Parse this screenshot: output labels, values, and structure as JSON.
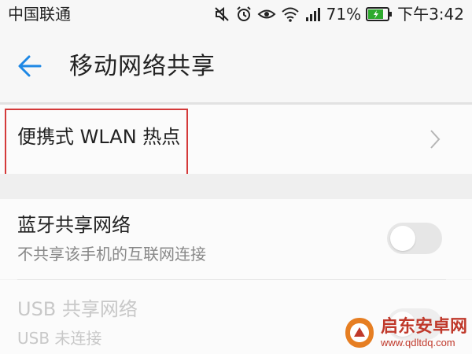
{
  "status_bar": {
    "carrier": "中国联通",
    "battery_percent": "71%",
    "time": "下午3:42",
    "icons": [
      "mute-icon",
      "alarm-icon",
      "eye-icon",
      "wifi-icon",
      "signal-icon",
      "battery-icon"
    ]
  },
  "app_bar": {
    "title": "移动网络共享"
  },
  "items": {
    "hotspot": {
      "label": "便携式 WLAN 热点"
    },
    "bluetooth": {
      "label": "蓝牙共享网络",
      "subtitle": "不共享该手机的互联网连接",
      "toggle_on": false
    },
    "usb": {
      "label": "USB 共享网络",
      "subtitle": "USB 未连接",
      "enabled": false
    }
  },
  "watermark": {
    "name": "启东安卓网",
    "url": "www.qdltdq.com"
  },
  "colors": {
    "accent": "#1e88e5",
    "highlight": "#d43a3a",
    "battery": "#2eaa2e",
    "watermark": "#c0392b"
  }
}
